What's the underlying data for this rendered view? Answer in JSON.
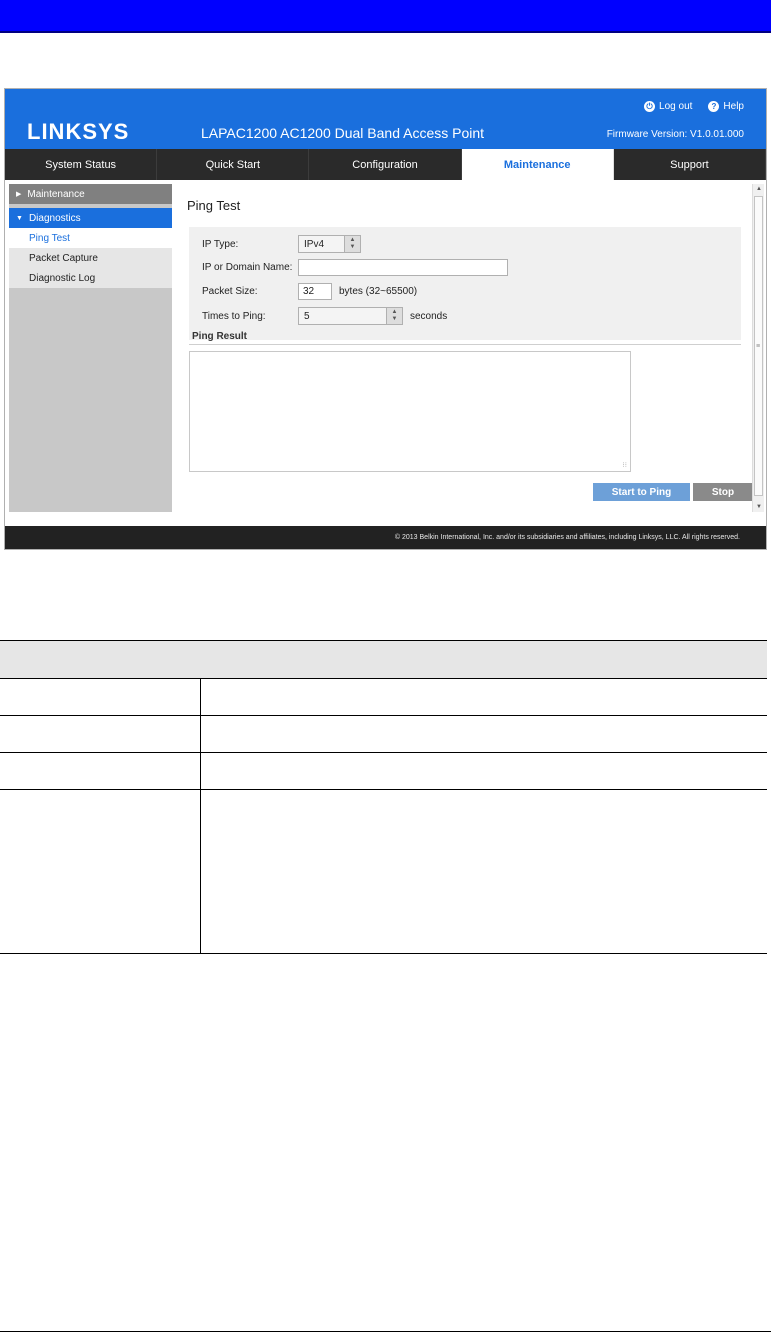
{
  "app": {
    "logo": "LINKSYS",
    "product_title": "LAPAC1200 AC1200 Dual Band Access Point",
    "logout_label": "Log out",
    "help_label": "Help",
    "firmware": "Firmware Version: V1.0.01.000",
    "colors": {
      "brand_blue": "#1a6fdd",
      "nav_dark": "#2a2a2a"
    }
  },
  "nav": {
    "tabs": [
      {
        "label": "System Status"
      },
      {
        "label": "Quick Start"
      },
      {
        "label": "Configuration"
      },
      {
        "label": "Maintenance"
      },
      {
        "label": "Support"
      }
    ]
  },
  "sidebar": {
    "maintenance": "Maintenance",
    "diagnostics": "Diagnostics",
    "items": [
      {
        "label": "Ping Test"
      },
      {
        "label": "Packet Capture"
      },
      {
        "label": "Diagnostic Log"
      }
    ]
  },
  "ping": {
    "title": "Ping Test",
    "ip_type_label": "IP Type:",
    "ip_type_value": "IPv4",
    "domain_label": "IP or Domain Name:",
    "domain_value": "",
    "packet_size_label": "Packet Size:",
    "packet_size_value": "32",
    "packet_size_unit": "bytes (32~65500)",
    "times_label": "Times to Ping:",
    "times_value": "5",
    "times_unit": "seconds",
    "result_title": "Ping Result",
    "start_button": "Start to Ping",
    "stop_button": "Stop"
  },
  "footer": {
    "copyright": "© 2013 Belkin International, Inc. and/or its subsidiaries and affiliates, including Linksys, LLC. All rights reserved."
  }
}
